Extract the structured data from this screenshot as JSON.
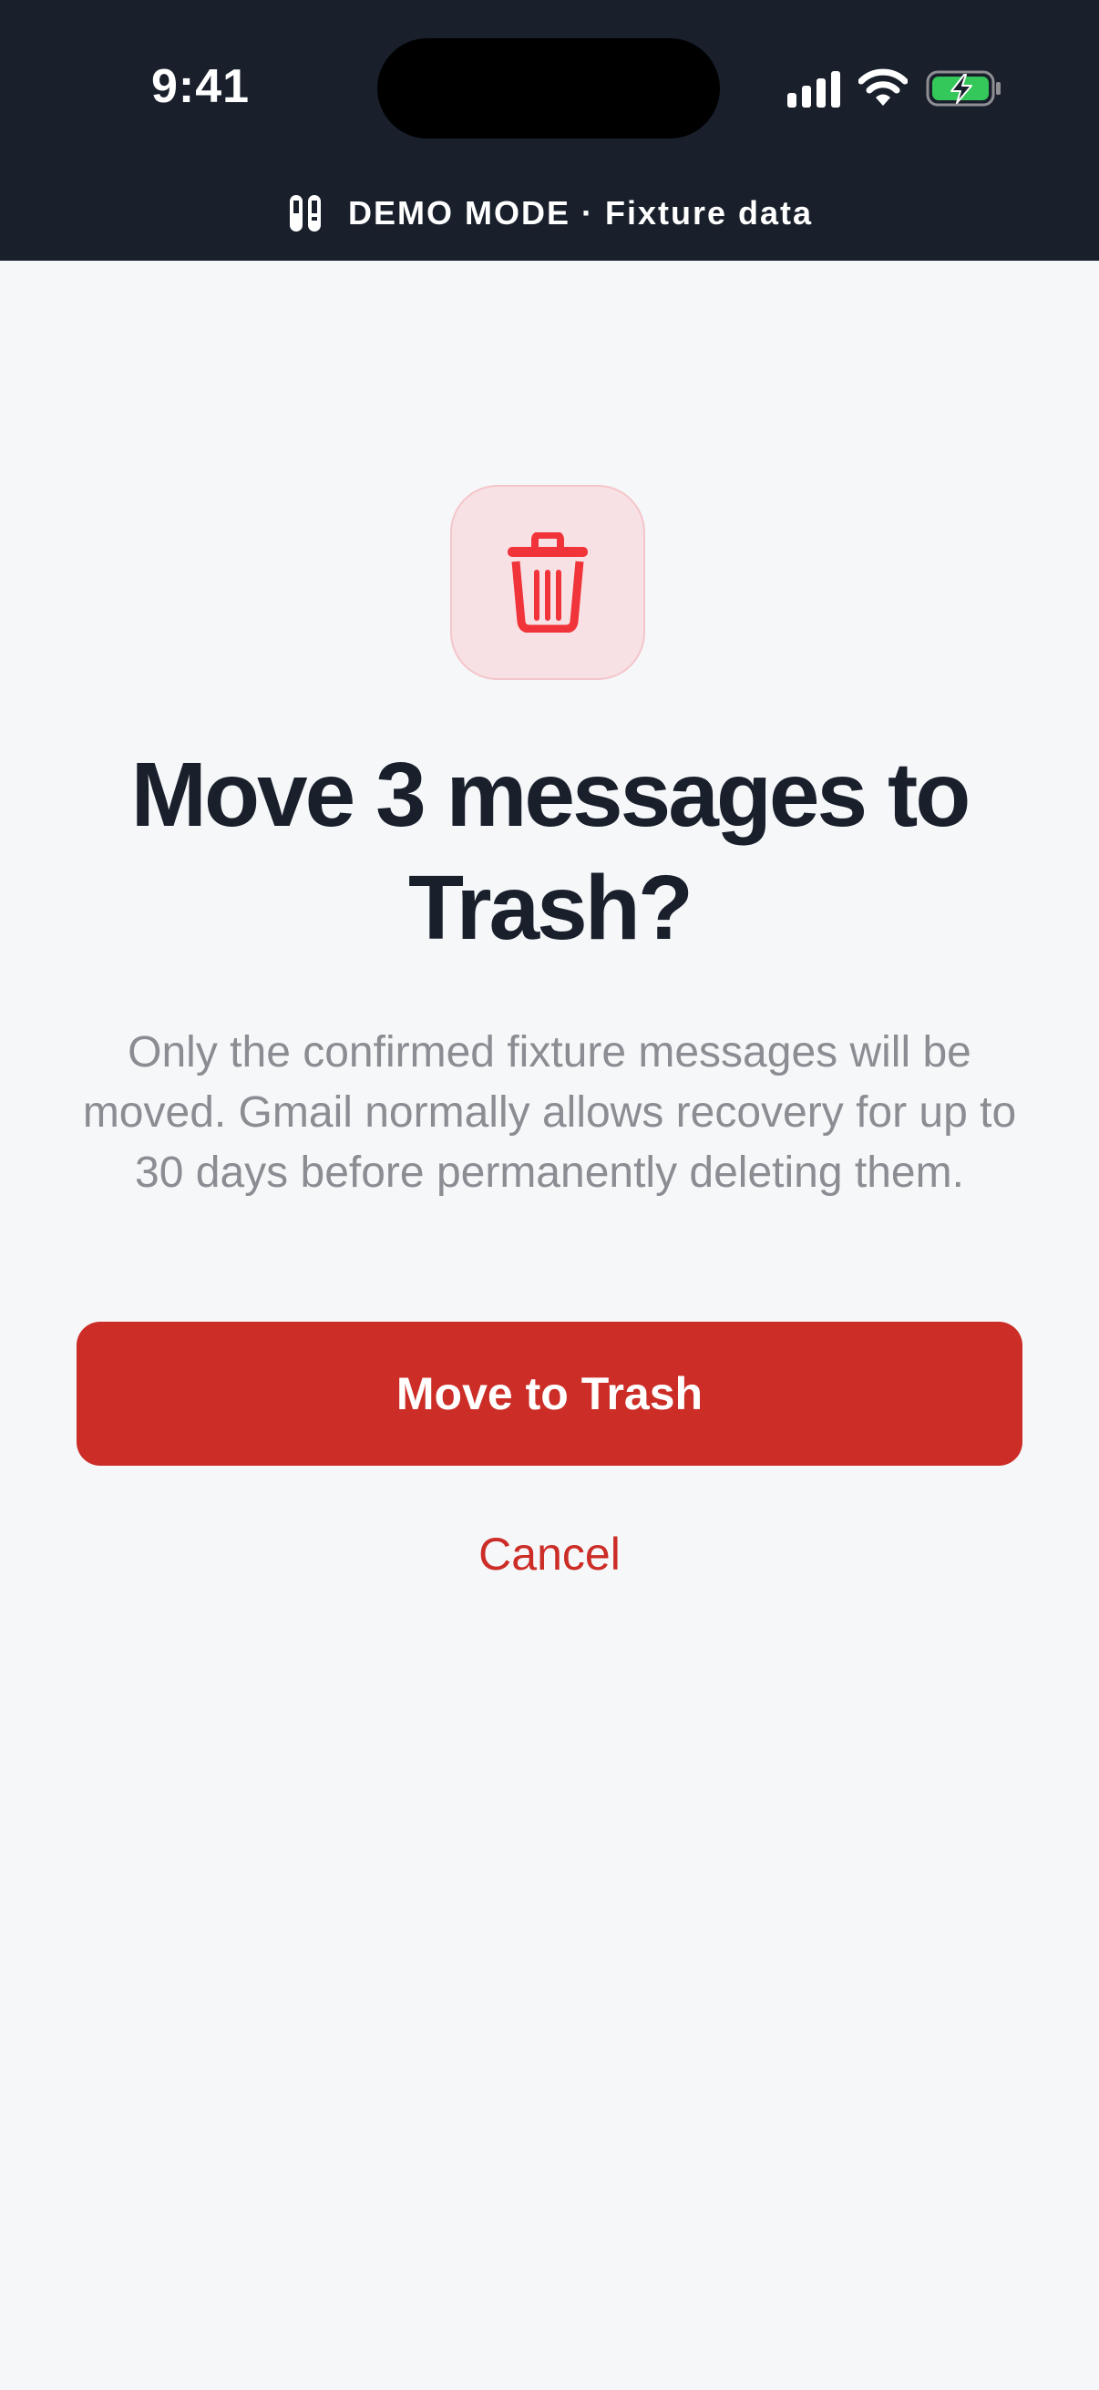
{
  "status_bar": {
    "time": "9:41",
    "icons": [
      "cellular-signal-icon",
      "wifi-icon",
      "battery-charging-icon"
    ]
  },
  "demo_banner": {
    "icon": "test-tubes-icon",
    "text": "DEMO MODE · Fixture data"
  },
  "dialog": {
    "icon": "trash-icon",
    "title": "Move 3 messages to Trash?",
    "description": "Only the confirmed fixture messages will be moved. Gmail normally allows recovery for up to 30 days before permanently deleting them.",
    "confirm_label": "Move to Trash",
    "cancel_label": "Cancel"
  },
  "colors": {
    "header_background": "#19202c",
    "page_background": "#f6f7f9",
    "destructive": "#cc2d27",
    "destructive_icon": "#f0343a",
    "icon_tile": "#f8e1e4",
    "battery_fill": "#34c759"
  }
}
